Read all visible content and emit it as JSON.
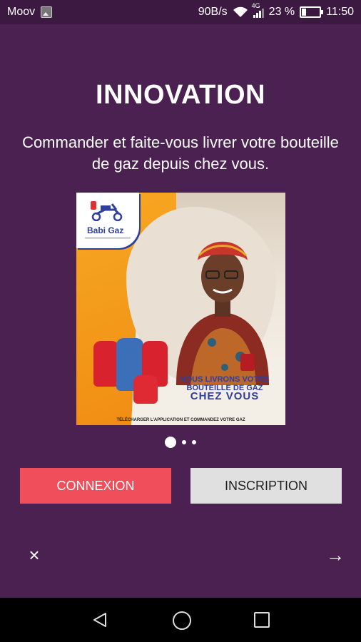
{
  "status": {
    "carrier": "Moov",
    "net_speed": "90B/s",
    "network": "4G",
    "battery": "23 %",
    "time": "11:50"
  },
  "onboarding": {
    "title": "INNOVATION",
    "subtitle": "Commander et faite-vous livrer votre bouteille de gaz depuis chez vous.",
    "page_index": 1,
    "page_count": 3
  },
  "promo": {
    "brand": "Babi Gaz",
    "quote_line1": "NOUS LIVRONS VOTRE",
    "quote_line2": "BOUTEILLE DE GAZ",
    "quote_line3": "CHEZ VOUS",
    "footer": "TÉLÉCHARGER L'APPLICATION ET COMMANDEZ VOTRE GAZ",
    "colors": {
      "orange": "#f7a823",
      "brand_blue": "#2f3f9e",
      "cylinder_red": "#d8232e",
      "cylinder_blue": "#3b6fb8"
    }
  },
  "buttons": {
    "login": "CONNEXION",
    "signup": "INSCRIPTION"
  },
  "controls": {
    "close_icon": "×",
    "next_icon": "→"
  },
  "theme": {
    "background": "#4a2151",
    "login_button": "#f04e5a",
    "signup_button": "#e0e0e0"
  }
}
